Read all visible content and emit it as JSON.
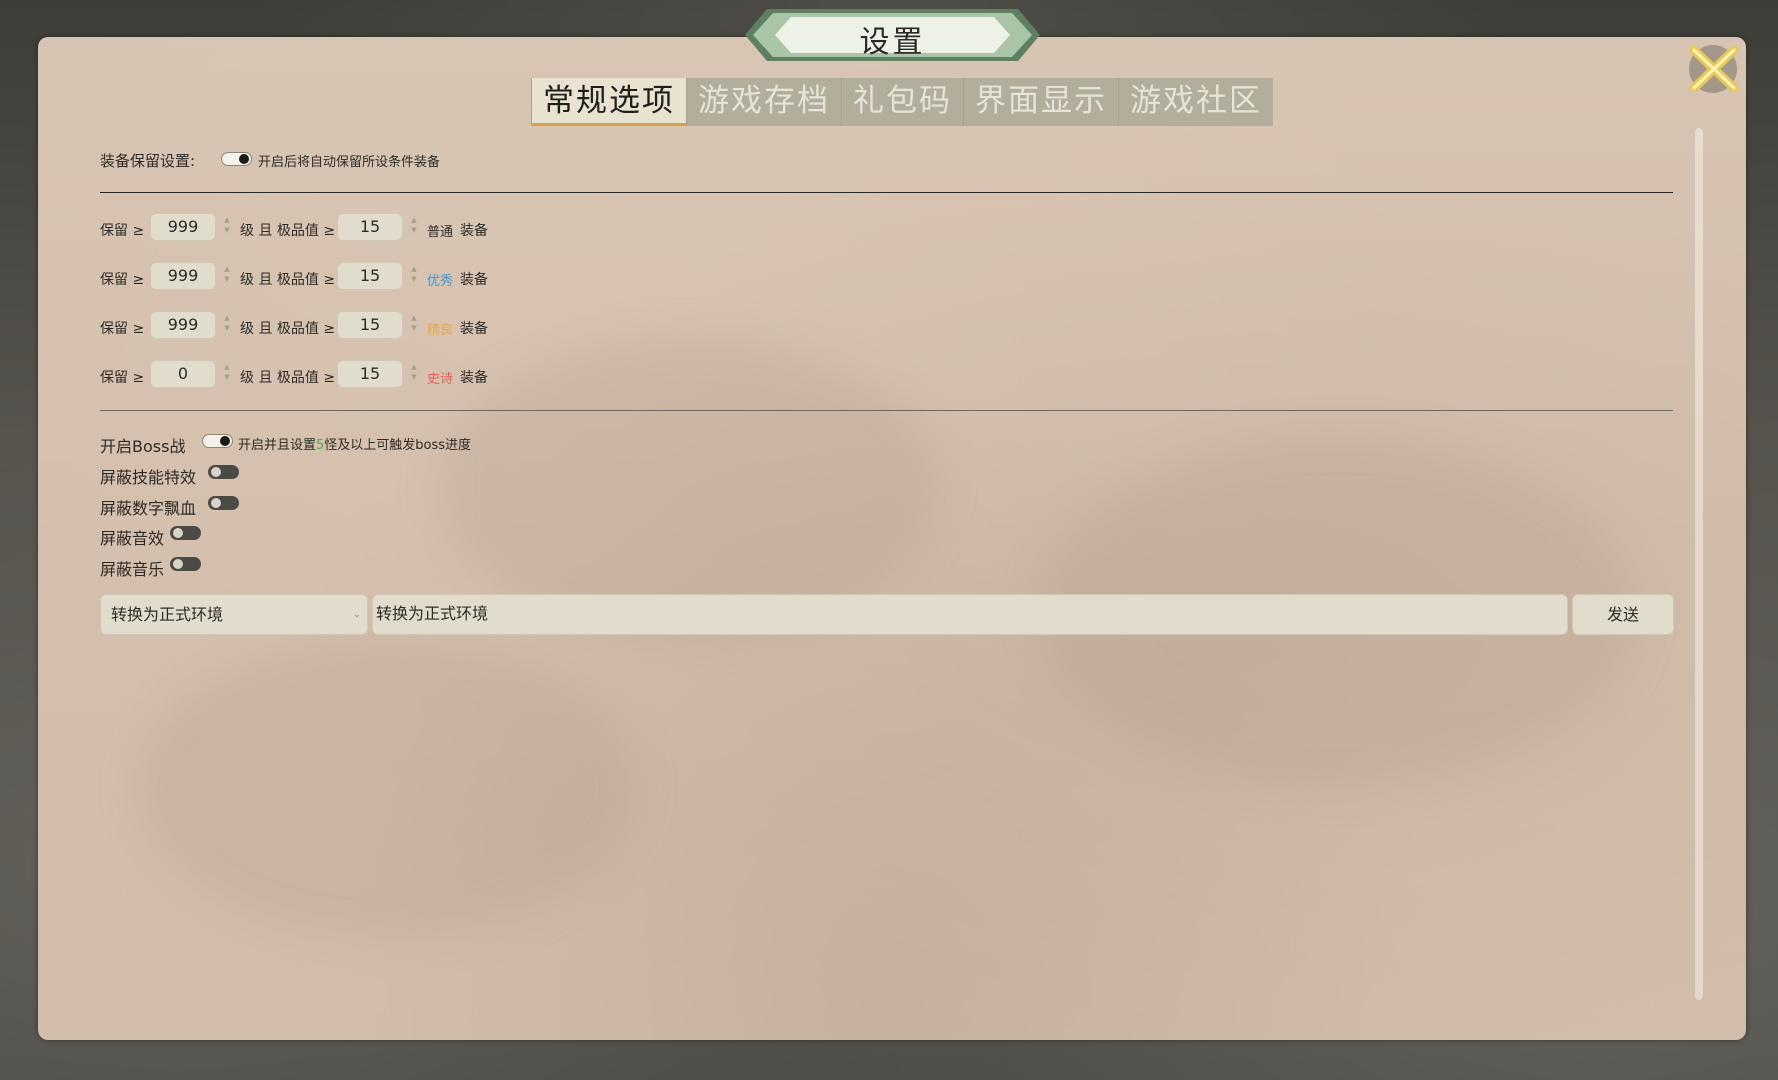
{
  "title": "设置",
  "tabs": [
    "常规选项",
    "游戏存档",
    "礼包码",
    "界面显示",
    "游戏社区"
  ],
  "equip_retention": {
    "label": "装备保留设置:",
    "desc": "开启后将自动保留所设条件装备",
    "enabled": true
  },
  "retain_rows": [
    {
      "prefix": "保留 ≥",
      "level": "999",
      "mid": "级 且 极品值 ≥",
      "value": "15",
      "quality": "普通",
      "quality_color": "#2d2b27",
      "suffix": "装备"
    },
    {
      "prefix": "保留 ≥",
      "level": "999",
      "mid": "级 且 极品值 ≥",
      "value": "15",
      "quality": "优秀",
      "quality_color": "#3a9ad9",
      "suffix": "装备"
    },
    {
      "prefix": "保留 ≥",
      "level": "999",
      "mid": "级 且 极品值 ≥",
      "value": "15",
      "quality": "精良",
      "quality_color": "#e8a94a",
      "suffix": "装备"
    },
    {
      "prefix": "保留 ≥",
      "level": "0",
      "mid": "级 且 极品值 ≥",
      "value": "15",
      "quality": "史诗",
      "quality_color": "#e0605a",
      "suffix": "装备"
    }
  ],
  "boss": {
    "label": "开启Boss战",
    "desc_pre": "开启并且设置",
    "desc_num": "5",
    "desc_post": "怪及以上可触发boss进度",
    "enabled": true
  },
  "toggles": [
    {
      "label": "屏蔽技能特效",
      "enabled": false
    },
    {
      "label": "屏蔽数字飘血",
      "enabled": false
    },
    {
      "label": "屏蔽音效",
      "enabled": false
    },
    {
      "label": "屏蔽音乐",
      "enabled": false
    }
  ],
  "command": {
    "select_value": "转换为正式环境",
    "input_value": "转换为正式环境",
    "send_label": "发送"
  },
  "colors": {
    "accent_tab_underline": "#d9a24a",
    "green_number": "#4caf50"
  }
}
